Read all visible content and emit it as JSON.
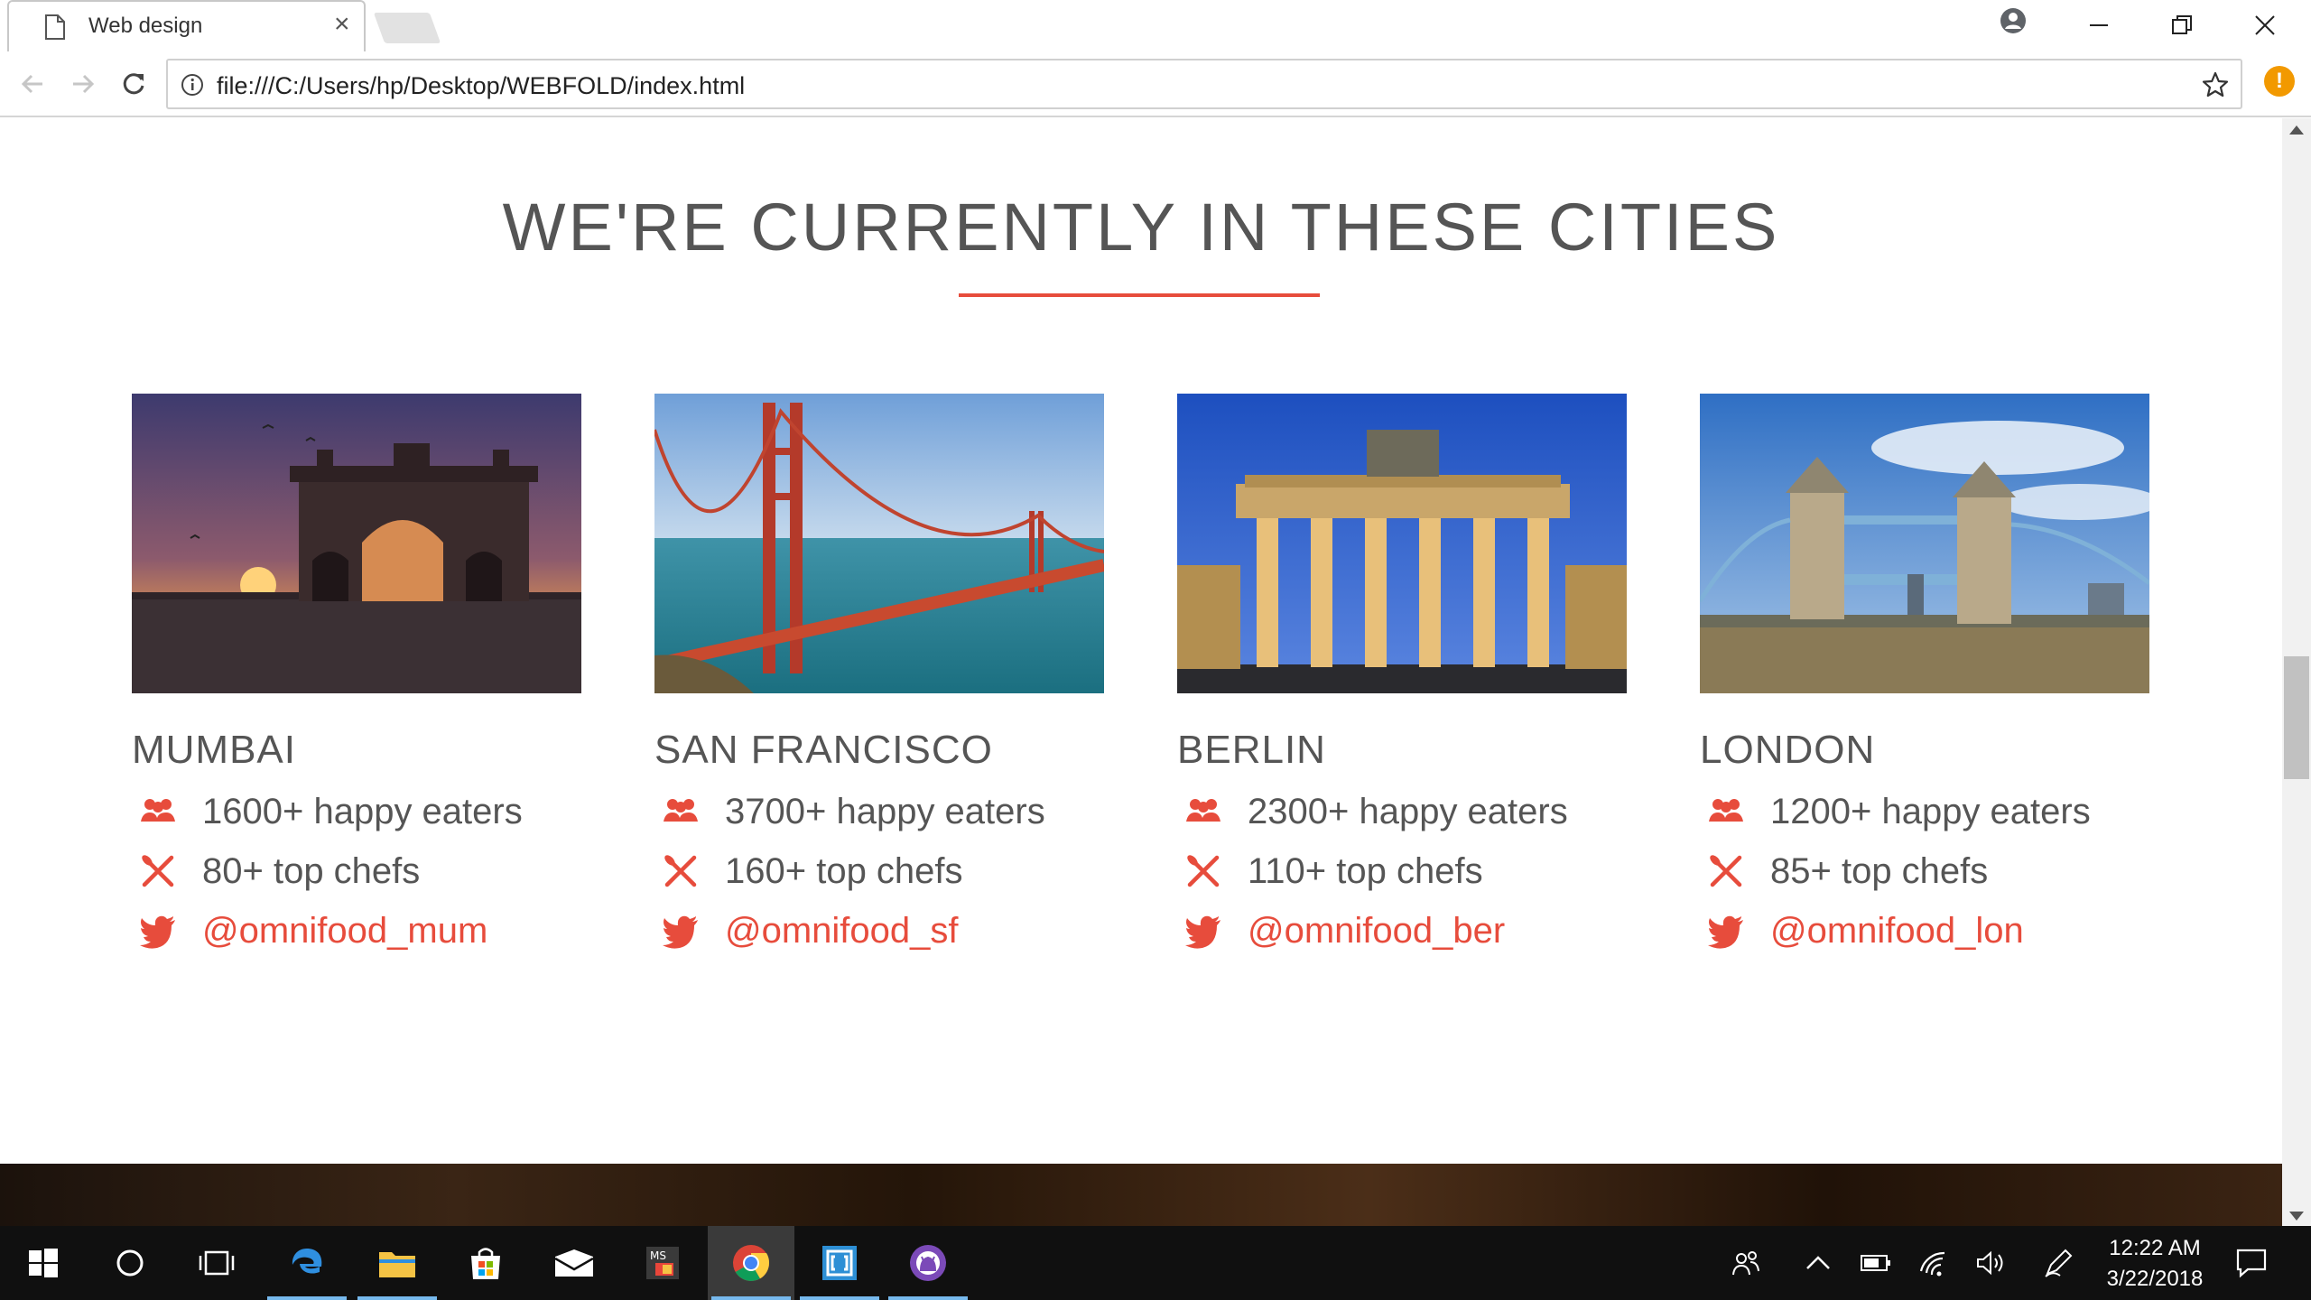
{
  "browser": {
    "tab_title": "Web design",
    "tab_close": "×",
    "url": "file:///C:/Users/hp/Desktop/WEBFOLD/index.html",
    "alert_badge": "!"
  },
  "page": {
    "section_title": "WE'RE CURRENTLY IN THESE CITIES",
    "cities": [
      {
        "name": "MUMBAI",
        "eaters": "1600+ happy eaters",
        "chefs": "80+ top chefs",
        "twitter": "@omnifood_mum"
      },
      {
        "name": "SAN FRANCISCO",
        "eaters": "3700+ happy eaters",
        "chefs": "160+ top chefs",
        "twitter": "@omnifood_sf"
      },
      {
        "name": "BERLIN",
        "eaters": "2300+ happy eaters",
        "chefs": "110+ top chefs",
        "twitter": "@omnifood_ber"
      },
      {
        "name": "LONDON",
        "eaters": "1200+ happy eaters",
        "chefs": "85+ top chefs",
        "twitter": "@omnifood_lon"
      }
    ],
    "accent_color": "#e74c3c"
  },
  "taskbar": {
    "time": "12:22 AM",
    "date": "3/22/2018",
    "apps": [
      "start-icon",
      "cortana-icon",
      "task-view-icon",
      "edge-icon",
      "file-explorer-icon",
      "store-icon",
      "mail-icon",
      "ms-app-icon",
      "chrome-icon",
      "brackets-icon",
      "github-icon"
    ]
  }
}
